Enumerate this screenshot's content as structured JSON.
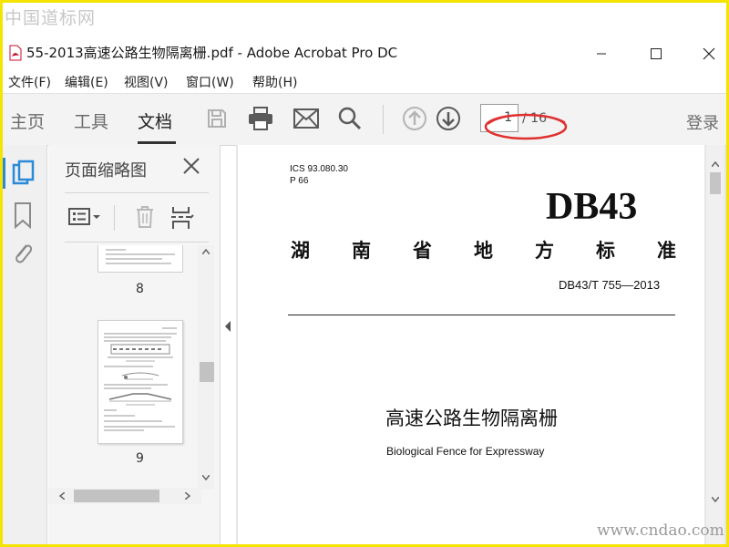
{
  "watermark": {
    "top": "中国道标网",
    "bottom": "www.cndao.com"
  },
  "window": {
    "title": "55-2013高速公路生物隔离栅.pdf - Adobe Acrobat Pro DC",
    "icon": "pdf-file-icon"
  },
  "menu": [
    "文件(F)",
    "编辑(E)",
    "视图(V)",
    "窗口(W)",
    "帮助(H)"
  ],
  "toolbar": {
    "tabs": [
      "主页",
      "工具",
      "文档"
    ],
    "active_tab": "文档",
    "icons": [
      "save-icon",
      "print-icon",
      "email-icon",
      "search-icon",
      "prev-page-icon",
      "next-page-icon"
    ],
    "page_input_value": "1",
    "page_total": "/ 16",
    "login": "登录",
    "highlight_color": "#e03030"
  },
  "sidebar": {
    "rail_icons": [
      "page-thumbnails-icon",
      "bookmark-icon",
      "attachment-icon"
    ],
    "panel_title": "页面缩略图",
    "thumbnails": [
      {
        "label": "8"
      },
      {
        "label": "9"
      }
    ]
  },
  "document": {
    "ics": "ICS 93.080.30",
    "p": "P 66",
    "code_big": "DB43",
    "standard_chars": [
      "湖",
      "南",
      "省",
      "地",
      "方",
      "标",
      "准"
    ],
    "standard_no": "DB43/T 755—2013",
    "title_cn": "高速公路生物隔离栅",
    "title_en": "Biological Fence for Expressway"
  },
  "colors": {
    "accent": "#2b8ad8",
    "border": "#f5e400"
  }
}
